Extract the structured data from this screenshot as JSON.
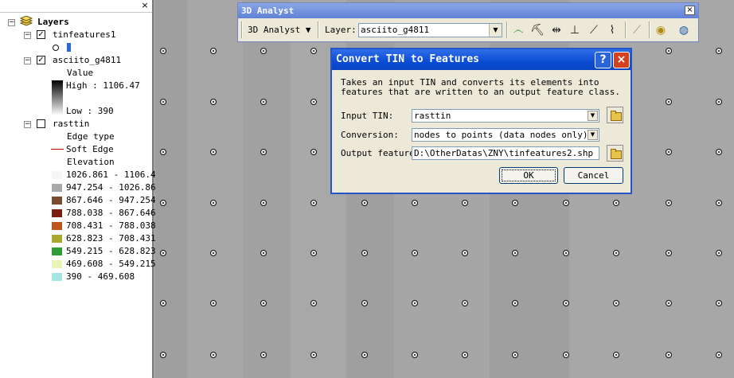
{
  "toc": {
    "close_glyph": "×",
    "root_label": "Layers",
    "layers": [
      {
        "name": "tinfeatures1",
        "checked": true
      },
      {
        "name": "asciito_g4811",
        "checked": true,
        "value_heading": "Value",
        "high_label": "High : 1106.47",
        "low_label": "Low : 390"
      },
      {
        "name": "rasttin",
        "checked": false,
        "edge_type": "Edge type",
        "soft_edge": "Soft Edge",
        "elevation": "Elevation"
      }
    ],
    "elevation_classes": [
      {
        "range": "1026.861 - 1106.4",
        "color": "#f6f6f6"
      },
      {
        "range": "947.254 - 1026.86",
        "color": "#a9a9a9"
      },
      {
        "range": "867.646 - 947.254",
        "color": "#7a4a2e"
      },
      {
        "range": "788.038 - 867.646",
        "color": "#7a1f0f"
      },
      {
        "range": "708.431 - 788.038",
        "color": "#c0531e"
      },
      {
        "range": "628.823 - 708.431",
        "color": "#a8a82a"
      },
      {
        "range": "549.215 - 628.823",
        "color": "#2e9c35"
      },
      {
        "range": "469.608 - 549.215",
        "color": "#e9f5b8"
      },
      {
        "range": "390 - 469.608",
        "color": "#a6e6e0"
      }
    ],
    "soft_edge_color": "#c00000"
  },
  "toolbar": {
    "title": "3D Analyst",
    "menu_label": "3D Analyst ▼",
    "layer_label": "Layer:",
    "layer_value": "asciito_g4811",
    "close_glyph": "×"
  },
  "dialog": {
    "title": "Convert TIN to Features",
    "help_glyph": "?",
    "close_glyph": "×",
    "description": "Takes an input TIN and converts its elements into features that are written to an output feature class.",
    "input_label": "Input TIN:",
    "input_value": "rasttin",
    "conversion_label": "Conversion:",
    "conversion_value": "nodes to points (data nodes only)",
    "output_label": "Output feature",
    "output_value": "D:\\OtherDatas\\ZNY\\tinfeatures2.shp",
    "ok_label": "OK",
    "cancel_label": "Cancel"
  },
  "colors": {
    "titlebar_blue": "#0b4cd4",
    "close_red": "#d4411e",
    "map_gray": "#a4a4a4"
  }
}
